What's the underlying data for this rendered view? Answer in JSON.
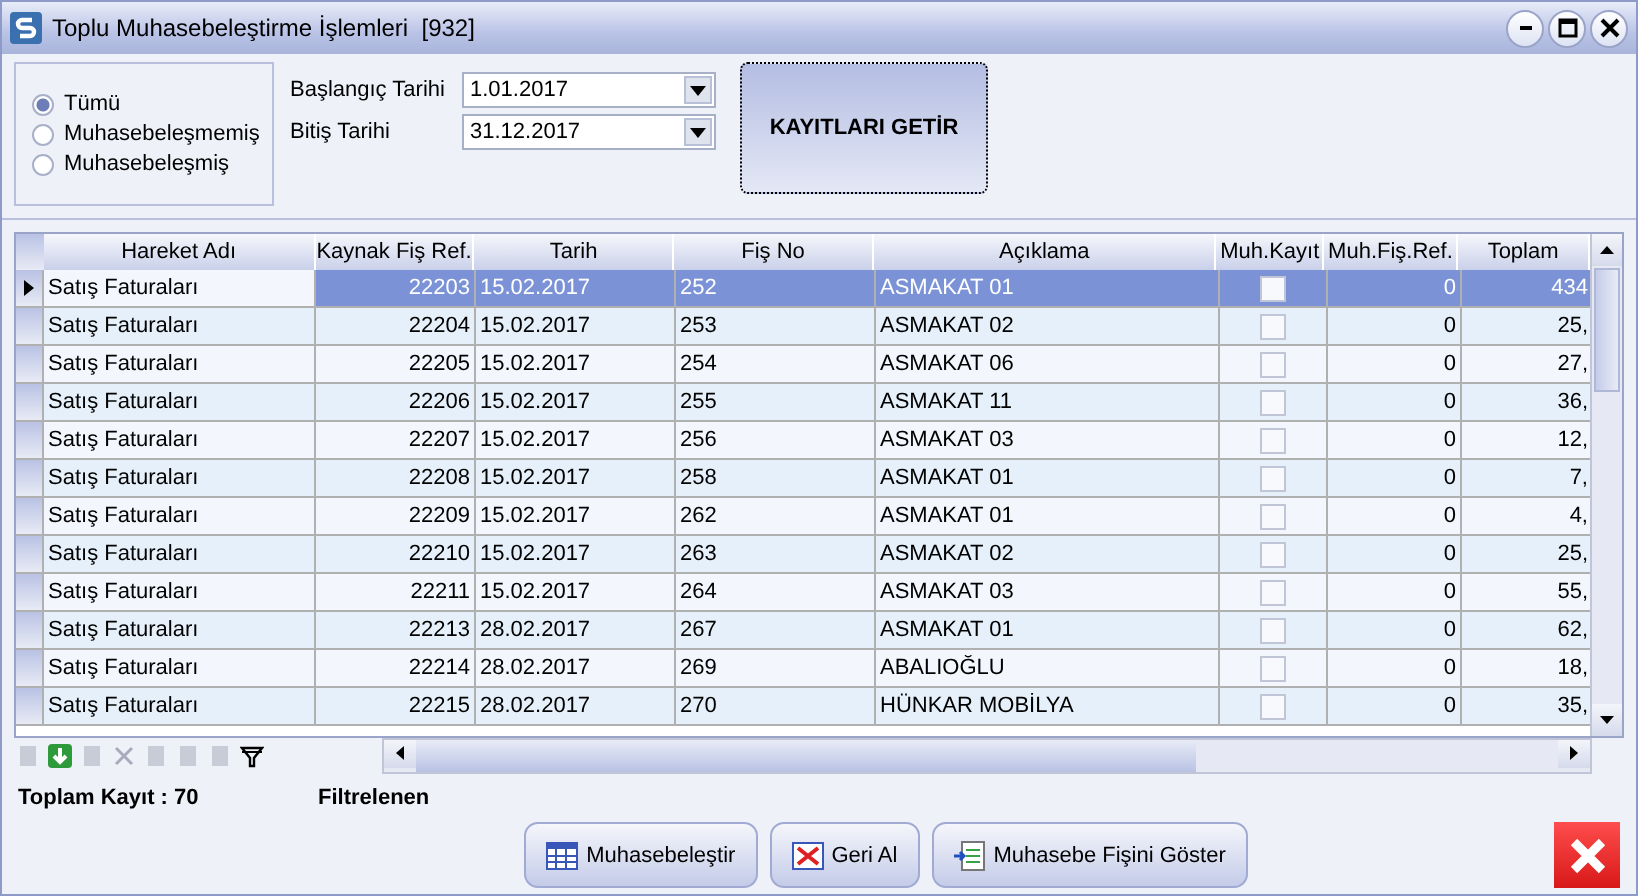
{
  "window": {
    "title": "Toplu Muhasebeleştirme İşlemleri  [932]"
  },
  "filter_options": [
    {
      "label": "Tümü",
      "selected": true
    },
    {
      "label": "Muhasebeleşmemiş",
      "selected": false
    },
    {
      "label": "Muhasebeleşmiş",
      "selected": false
    }
  ],
  "date_fields": [
    {
      "label": "Başlangıç Tarihi",
      "value": "1.01.2017"
    },
    {
      "label": "Bitiş Tarihi",
      "value": "31.12.2017"
    }
  ],
  "fetch_button": "KAYITLARI GETİR",
  "table": {
    "columns": [
      "Hareket Adı",
      "Kaynak Fiş Ref.",
      "Tarih",
      "Fiş No",
      "Açıklama",
      "Muh.Kayıt",
      "Muh.Fiş.Ref.",
      "Toplam"
    ],
    "rows": [
      {
        "selected": true,
        "hareket": "Satış Faturaları",
        "kaynak": "22203",
        "tarih": "15.02.2017",
        "fis_no": "252",
        "aciklama": "ASMAKAT 01",
        "muh_kayit": false,
        "muh_fis_ref": "0",
        "toplam": "434"
      },
      {
        "selected": false,
        "hareket": "Satış Faturaları",
        "kaynak": "22204",
        "tarih": "15.02.2017",
        "fis_no": "253",
        "aciklama": "ASMAKAT 02",
        "muh_kayit": false,
        "muh_fis_ref": "0",
        "toplam": "25,"
      },
      {
        "selected": false,
        "hareket": "Satış Faturaları",
        "kaynak": "22205",
        "tarih": "15.02.2017",
        "fis_no": "254",
        "aciklama": "ASMAKAT 06",
        "muh_kayit": false,
        "muh_fis_ref": "0",
        "toplam": "27,"
      },
      {
        "selected": false,
        "hareket": "Satış Faturaları",
        "kaynak": "22206",
        "tarih": "15.02.2017",
        "fis_no": "255",
        "aciklama": "ASMAKAT 11",
        "muh_kayit": false,
        "muh_fis_ref": "0",
        "toplam": "36,"
      },
      {
        "selected": false,
        "hareket": "Satış Faturaları",
        "kaynak": "22207",
        "tarih": "15.02.2017",
        "fis_no": "256",
        "aciklama": "ASMAKAT 03",
        "muh_kayit": false,
        "muh_fis_ref": "0",
        "toplam": "12,"
      },
      {
        "selected": false,
        "hareket": "Satış Faturaları",
        "kaynak": "22208",
        "tarih": "15.02.2017",
        "fis_no": "258",
        "aciklama": "ASMAKAT 01",
        "muh_kayit": false,
        "muh_fis_ref": "0",
        "toplam": "7,"
      },
      {
        "selected": false,
        "hareket": "Satış Faturaları",
        "kaynak": "22209",
        "tarih": "15.02.2017",
        "fis_no": "262",
        "aciklama": "ASMAKAT 01",
        "muh_kayit": false,
        "muh_fis_ref": "0",
        "toplam": "4,"
      },
      {
        "selected": false,
        "hareket": "Satış Faturaları",
        "kaynak": "22210",
        "tarih": "15.02.2017",
        "fis_no": "263",
        "aciklama": "ASMAKAT 02",
        "muh_kayit": false,
        "muh_fis_ref": "0",
        "toplam": "25,"
      },
      {
        "selected": false,
        "hareket": "Satış Faturaları",
        "kaynak": "22211",
        "tarih": "15.02.2017",
        "fis_no": "264",
        "aciklama": "ASMAKAT 03",
        "muh_kayit": false,
        "muh_fis_ref": "0",
        "toplam": "55,"
      },
      {
        "selected": false,
        "hareket": "Satış Faturaları",
        "kaynak": "22213",
        "tarih": "28.02.2017",
        "fis_no": "267",
        "aciklama": "ASMAKAT 01",
        "muh_kayit": false,
        "muh_fis_ref": "0",
        "toplam": "62,"
      },
      {
        "selected": false,
        "hareket": "Satış Faturaları",
        "kaynak": "22214",
        "tarih": "28.02.2017",
        "fis_no": "269",
        "aciklama": "ABALIOĞLU",
        "muh_kayit": false,
        "muh_fis_ref": "0",
        "toplam": "18,"
      },
      {
        "selected": false,
        "hareket": "Satış Faturaları",
        "kaynak": "22215",
        "tarih": "28.02.2017",
        "fis_no": "270",
        "aciklama": "HÜNKAR MOBİLYA",
        "muh_kayit": false,
        "muh_fis_ref": "0",
        "toplam": "35,"
      }
    ]
  },
  "status": {
    "total": "Toplam Kayıt : 70",
    "filtered": "Filtrelenen"
  },
  "buttons": [
    {
      "kind": "post",
      "label": "Muhasebeleştir"
    },
    {
      "kind": "undo",
      "label": "Geri Al"
    },
    {
      "kind": "show",
      "label": "Muhasebe Fişini Göster"
    }
  ]
}
